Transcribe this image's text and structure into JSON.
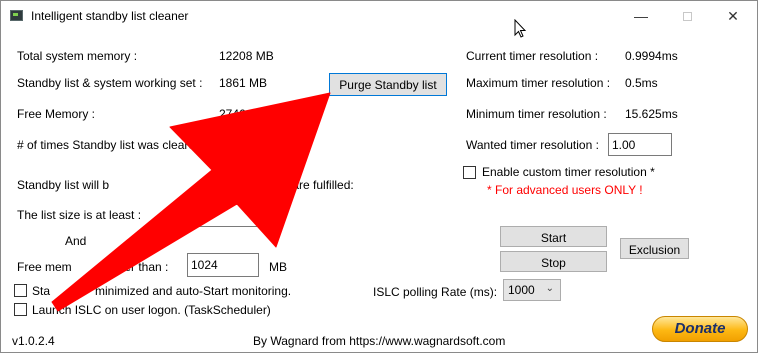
{
  "window": {
    "title": "Intelligent standby list cleaner",
    "min_glyph": "—",
    "close_glyph": "✕"
  },
  "memory": {
    "total_label": "Total system memory :",
    "total_value": "12208 MB",
    "standby_label": "Standby list & system working set :",
    "standby_value": "1861 MB",
    "free_label": "Free Memory :",
    "free_value": "2746 MB",
    "cleared_label": "# of times Standby list was cleared"
  },
  "buttons": {
    "purge": "Purge Standby list",
    "start": "Start",
    "stop": "Stop",
    "exclusion": "Exclusion"
  },
  "timer": {
    "current_label": "Current timer resolution :",
    "current_value": "0.9994ms",
    "max_label": "Maximum timer resolution :",
    "max_value": "0.5ms",
    "min_label": "Minimum timer resolution :",
    "min_value": "15.625ms",
    "wanted_label": "Wanted timer resolution :",
    "wanted_value": "1.00",
    "custom_label": "Enable custom timer resolution *",
    "custom_checked": false,
    "warning": "* For advanced users ONLY !"
  },
  "conditions": {
    "intro_start": "Standby list will b",
    "intro_end": "onditions are fulfilled:",
    "list_size_label": "The list size is at least :",
    "list_size_value": "",
    "list_size_unit": "MB",
    "and_label": "And",
    "free_mem_start": "Free mem",
    "free_mem_end": "ower than :",
    "free_mem_value": "1024",
    "free_mem_unit": "MB"
  },
  "options": {
    "start_minimized_start": "Sta",
    "start_minimized_end": "minimized and auto-Start monitoring.",
    "start_minimized_checked": false,
    "launch_logon": "Launch ISLC on user logon. (TaskScheduler)",
    "launch_logon_checked": false
  },
  "polling": {
    "label": "ISLC polling Rate (ms):",
    "value": "1000"
  },
  "footer": {
    "version": "v1.0.2.4",
    "credit": "By Wagnard from https://www.wagnardsoft.com",
    "donate": "Donate"
  },
  "colors": {
    "annotation_arrow": "#ff0000",
    "warning_text": "#ff0000",
    "donate_fill": "#fdb813"
  },
  "icons": {
    "app": "app-icon",
    "dropdown": "chevron-down-icon",
    "pointer": "mouse-cursor-icon",
    "annotation": "red-arrow-icon"
  }
}
